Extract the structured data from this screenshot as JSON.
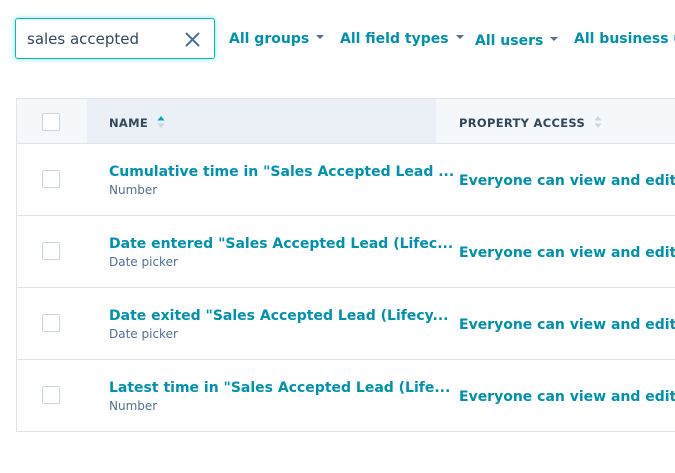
{
  "search": {
    "value": "sales accepted"
  },
  "filters": [
    {
      "label": "All groups"
    },
    {
      "label": "All field types"
    },
    {
      "label": "All users"
    },
    {
      "label": "All business un"
    }
  ],
  "table": {
    "columns": [
      {
        "label": "NAME",
        "sort": "ascending"
      },
      {
        "label": "PROPERTY ACCESS",
        "sort": "none"
      }
    ],
    "rows": [
      {
        "name": "Cumulative time in \"Sales Accepted Lead ...",
        "type": "Number",
        "access": "Everyone can view and edit"
      },
      {
        "name": "Date entered \"Sales Accepted Lead (Lifec...",
        "type": "Date picker",
        "access": "Everyone can view and edit"
      },
      {
        "name": "Date exited \"Sales Accepted Lead (Lifecy...",
        "type": "Date picker",
        "access": "Everyone can view and edit"
      },
      {
        "name": "Latest time in \"Sales Accepted Lead (Life...",
        "type": "Number",
        "access": "Everyone can view and edit"
      }
    ]
  },
  "colors": {
    "link": "#0091ae",
    "focus_border": "#00bda5",
    "header_bg": "#f5f8fa",
    "sorted_header_bg": "#eaf0f6",
    "text": "#33475b"
  },
  "icons": {
    "search_clear": "close-icon",
    "filter_caret": "caret-down-icon",
    "sort_asc": "sort-ascending-icon",
    "sort_none": "sort-icon"
  }
}
